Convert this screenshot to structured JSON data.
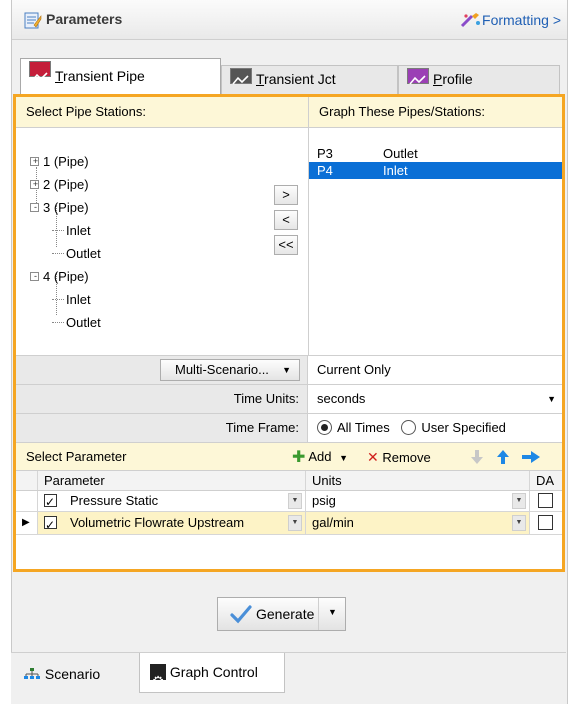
{
  "header": {
    "title": "Parameters",
    "formatting_label": "Formatting >"
  },
  "tabs": [
    {
      "prefix": "",
      "underlined": "T",
      "rest": "ransient Pipe",
      "active": true
    },
    {
      "prefix": "",
      "underlined": "T",
      "rest": "ransient Jct",
      "active": false
    },
    {
      "prefix": "",
      "underlined": "P",
      "rest": "rofile",
      "active": false
    }
  ],
  "stations": {
    "left_header": "Select Pipe Stations:",
    "right_header": "Graph These Pipes/Stations:",
    "tree": [
      {
        "label": "1 (Pipe)",
        "expander": "+"
      },
      {
        "label": "2 (Pipe)",
        "expander": "+"
      },
      {
        "label": "3 (Pipe)",
        "expander": "-",
        "children": [
          "Inlet",
          "Outlet"
        ]
      },
      {
        "label": "4 (Pipe)",
        "expander": "-",
        "children": [
          "Inlet",
          "Outlet"
        ]
      }
    ],
    "buttons": {
      "add": ">",
      "remove": "<",
      "remove_all": "<<"
    },
    "selected": [
      {
        "pipe": "P3",
        "station": "Outlet"
      },
      {
        "pipe": "P4",
        "station": "Inlet"
      }
    ]
  },
  "scenario": {
    "button_label": "Multi-Scenario...",
    "value": "Current Only"
  },
  "time_units": {
    "label": "Time Units:",
    "value": "seconds"
  },
  "time_frame": {
    "label": "Time Frame:",
    "options": [
      "All Times",
      "User Specified"
    ],
    "selected": "All Times"
  },
  "parameters": {
    "title": "Select Parameter",
    "add_label": "Add",
    "remove_label": "Remove",
    "columns": [
      "Parameter",
      "Units",
      "DA"
    ],
    "rows": [
      {
        "checked": true,
        "name": "Pressure Static",
        "units": "psig",
        "da": false,
        "current": false
      },
      {
        "checked": true,
        "name": "Volumetric Flowrate Upstream",
        "units": "gal/min",
        "da": false,
        "current": true
      }
    ]
  },
  "generate_label": "Generate",
  "bottom_tabs": [
    {
      "label": "Scenario",
      "icon": "scenario-tree-icon",
      "active": false
    },
    {
      "label": "Graph Control",
      "icon": "gear-icon",
      "active": true
    }
  ],
  "colors": {
    "highlight_border": "#f5a623",
    "selection": "#0a6fd6",
    "header_yellow": "#fdf7d7",
    "link": "#1f5fb4"
  }
}
